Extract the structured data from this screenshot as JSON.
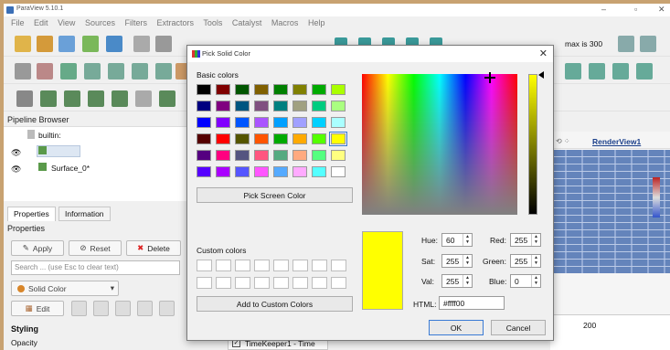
{
  "app": {
    "title": "ParaView 5.10.1",
    "menus": [
      "File",
      "Edit",
      "View",
      "Sources",
      "Filters",
      "Extractors",
      "Tools",
      "Catalyst",
      "Macros",
      "Help"
    ],
    "max_label": "max is 300",
    "pipeline_browser": "Pipeline Browser",
    "builtin": "builtin:",
    "surface": "Surface_0*",
    "tabs": [
      "Properties",
      "Information"
    ],
    "properties_header": "Properties",
    "apply": "Apply",
    "reset": "Reset",
    "delete": "Delete",
    "search_placeholder": "Search ... (use Esc to clear text)",
    "solid_color": "Solid Color",
    "edit": "Edit",
    "styling": "Styling",
    "opacity": "Opacity",
    "render_view": "RenderView1",
    "timekeeper": "TimeKeeper1 - Time",
    "timeline_tick": "200"
  },
  "dialog": {
    "title": "Pick Solid Color",
    "basic_colors_label": "Basic colors",
    "pick_screen_color": "Pick Screen Color",
    "custom_colors_label": "Custom colors",
    "add_custom": "Add to Custom Colors",
    "hue_label": "Hue:",
    "hue": "60",
    "sat_label": "Sat:",
    "sat": "255",
    "val_label": "Val:",
    "val": "255",
    "red_label": "Red:",
    "red": "255",
    "green_label": "Green:",
    "green": "255",
    "blue_label": "Blue:",
    "blue": "0",
    "html_label": "HTML:",
    "html": "#ffff00",
    "ok": "OK",
    "cancel": "Cancel",
    "selected_color": "#ffff00",
    "basic_colors": [
      [
        "#000000",
        "#800000",
        "#005500",
        "#806000",
        "#008000",
        "#808000",
        "#00aa00",
        "#aaff00"
      ],
      [
        "#000080",
        "#800080",
        "#005580",
        "#805080",
        "#008080",
        "#a0a080",
        "#00cc80",
        "#aaff80"
      ],
      [
        "#0000ff",
        "#8000ff",
        "#0055ff",
        "#aa55ff",
        "#00a0ff",
        "#a0a0ff",
        "#00d0ff",
        "#aaffff"
      ],
      [
        "#550000",
        "#ff0000",
        "#555500",
        "#ff5500",
        "#00aa00",
        "#ffaa00",
        "#55ff00",
        "#ffff00"
      ],
      [
        "#550080",
        "#ff0080",
        "#555580",
        "#ff5580",
        "#55aa80",
        "#ffaa80",
        "#55ff80",
        "#ffff80"
      ],
      [
        "#5500ff",
        "#aa00ff",
        "#5555ff",
        "#ff55ff",
        "#55aaff",
        "#ffaaff",
        "#55ffff",
        "#ffffff"
      ]
    ]
  }
}
